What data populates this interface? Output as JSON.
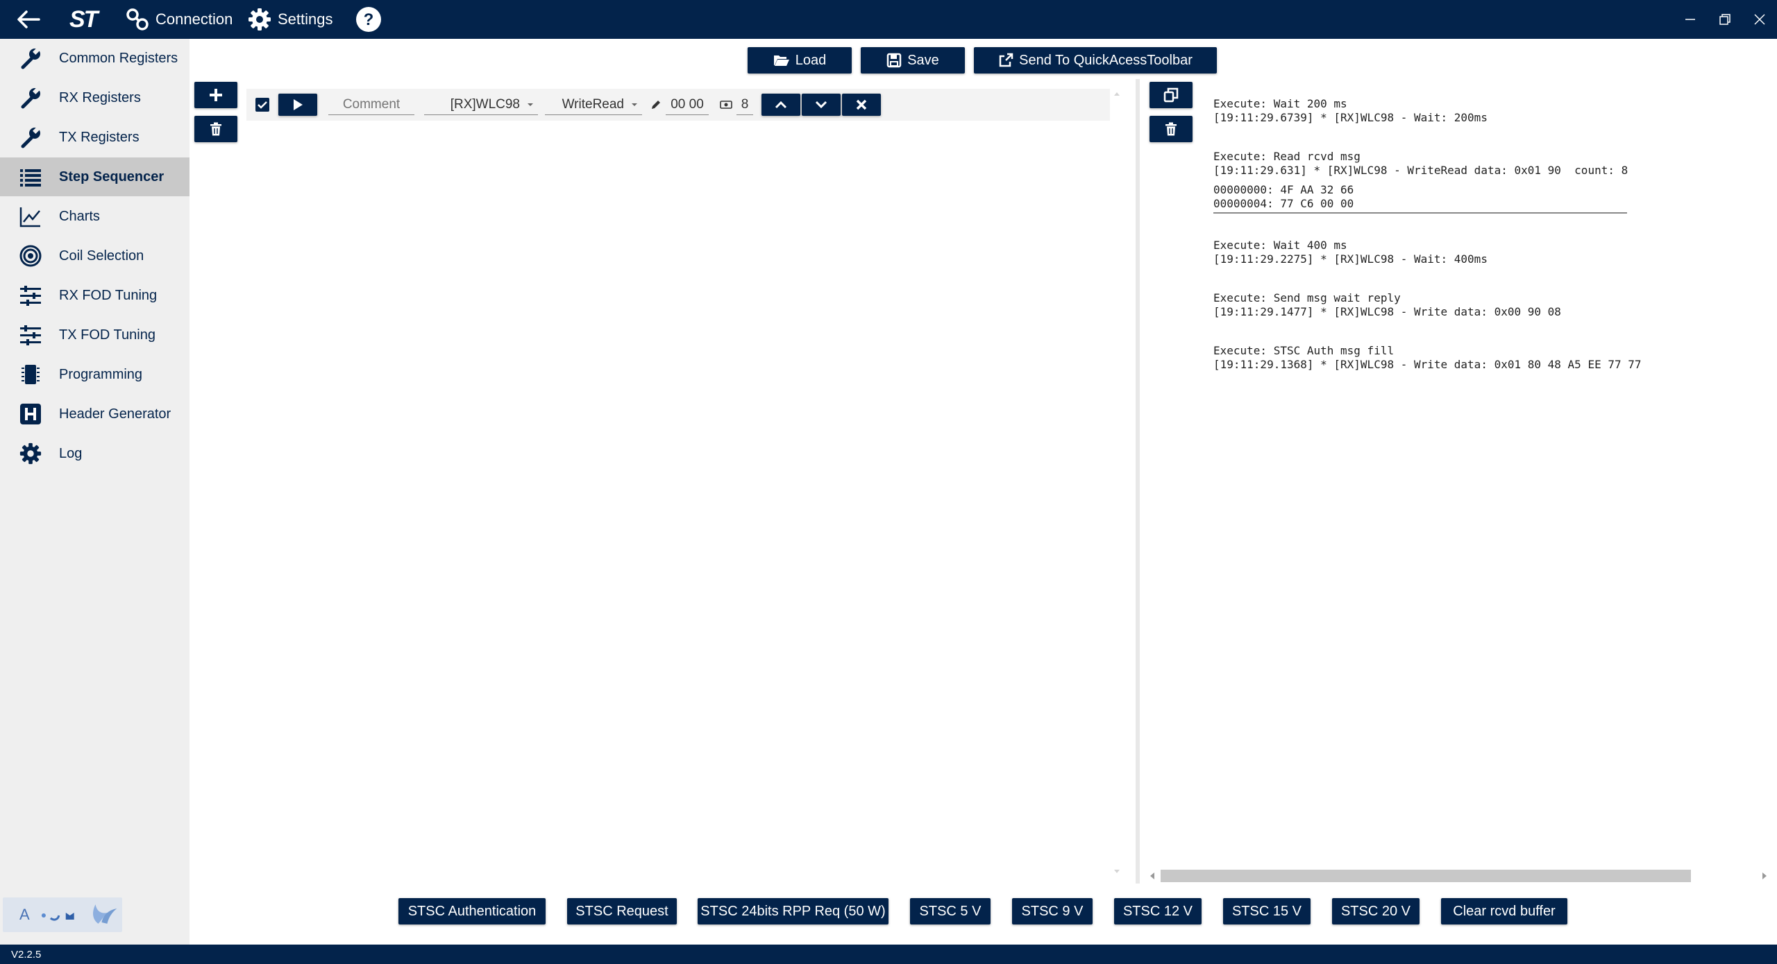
{
  "titlebar": {
    "connection_label": "Connection",
    "settings_label": "Settings",
    "logo_text": "ST",
    "back_icon": "back-arrow-icon",
    "help_icon": "help-icon"
  },
  "sidebar": {
    "items": [
      {
        "label": "Common Registers",
        "icon": "wrench-icon"
      },
      {
        "label": "RX Registers",
        "icon": "wrench-icon"
      },
      {
        "label": "TX Registers",
        "icon": "wrench-icon"
      },
      {
        "label": "Step Sequencer",
        "icon": "list-icon",
        "active": true
      },
      {
        "label": "Charts",
        "icon": "chart-icon"
      },
      {
        "label": "Coil Selection",
        "icon": "coil-icon"
      },
      {
        "label": "RX FOD Tuning",
        "icon": "sliders-icon"
      },
      {
        "label": "TX FOD Tuning",
        "icon": "sliders-icon"
      },
      {
        "label": "Programming",
        "icon": "chip-icon"
      },
      {
        "label": "Header Generator",
        "icon": "header-h-icon"
      },
      {
        "label": "Log",
        "icon": "gear-icon"
      }
    ],
    "lang_badge": "A"
  },
  "toolbar": {
    "load_label": "Load",
    "save_label": "Save",
    "send_label": "Send To QuickAcessToolbar"
  },
  "step": {
    "checked": true,
    "comment_placeholder": "Comment",
    "device": "[RX]WLC98",
    "operation": "WriteRead",
    "data": "00 00",
    "count": "8"
  },
  "log": {
    "blocks": [
      {
        "lines": [
          "Execute: Wait 200 ms",
          "[19:11:29.6739] * [RX]WLC98 - Wait: 200ms"
        ]
      },
      {
        "lines": [
          "Execute: Read rcvd msg",
          "[19:11:29.631] * [RX]WLC98 - WriteRead data: 0x01 90  count: 8"
        ],
        "hex": [
          "00000000: 4F AA 32 66",
          "00000004: 77 C6 00 00"
        ]
      },
      {
        "lines": [
          "Execute: Wait 400 ms",
          "[19:11:29.2275] * [RX]WLC98 - Wait: 400ms"
        ]
      },
      {
        "lines": [
          "Execute: Send msg wait reply",
          "[19:11:29.1477] * [RX]WLC98 - Write data: 0x00 90 08"
        ]
      },
      {
        "lines": [
          "Execute: STSC Auth msg fill",
          "[19:11:29.1368] * [RX]WLC98 - Write data: 0x01 80 48 A5 EE 77 77"
        ]
      }
    ]
  },
  "quick_buttons": [
    "STSC Authentication",
    "STSC Request",
    "STSC 24bits RPP Req (50 W)",
    "STSC 5 V",
    "STSC 9 V",
    "STSC 12 V",
    "STSC 15 V",
    "STSC 20 V",
    "Clear rcvd buffer"
  ],
  "version": "V2.2.5",
  "colors": {
    "primary": "#03234b",
    "sidebar_bg": "#efefef",
    "active_bg": "#c9c9c9"
  }
}
